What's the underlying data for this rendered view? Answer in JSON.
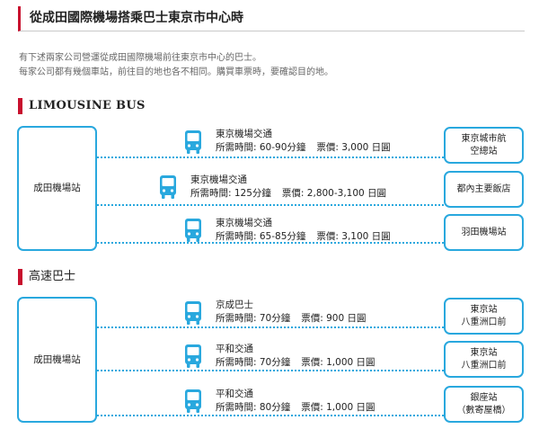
{
  "header": {
    "title": "從成田國際機場搭乘巴士東京市中心時"
  },
  "intro": {
    "line1": "有下述兩家公司營運從成田國際機場前往東京市中心的巴士。",
    "line2": "每家公司都有幾個車站，前往目的地也各不相同。購買車票時，要確認目的地。"
  },
  "sections": [
    {
      "title": "LIMOUSINE BUS",
      "origin": "成田機場站",
      "routes": [
        {
          "name": "東京機場交通",
          "time": "所需時間: 60-90分鐘",
          "fare": "票價: 3,000 日圓",
          "dest": [
            "東京城市航",
            "空總站"
          ]
        },
        {
          "name": "東京機場交通",
          "time": "所需時間: 125分鐘",
          "fare": "票價: 2,800-3,100 日圓",
          "dest": [
            "都內主要飯店"
          ]
        },
        {
          "name": "東京機場交通",
          "time": "所需時間: 65-85分鐘",
          "fare": "票價: 3,100 日圓",
          "dest": [
            "羽田機場站"
          ]
        }
      ]
    },
    {
      "title": "高速巴士",
      "origin": "成田機場站",
      "routes": [
        {
          "name": "京成巴士",
          "time": "所需時間: 70分鐘",
          "fare": "票價: 900 日圓",
          "dest": [
            "東京站",
            "八重洲口前"
          ]
        },
        {
          "name": "平和交通",
          "time": "所需時間: 70分鐘",
          "fare": "票價: 1,000 日圓",
          "dest": [
            "東京站",
            "八重洲口前"
          ]
        },
        {
          "name": "平和交通",
          "time": "所需時間: 80分鐘",
          "fare": "票價: 1,000 日圓",
          "dest": [
            "銀座站",
            "（數寄屋橋）"
          ]
        }
      ]
    }
  ],
  "colors": {
    "accent_red": "#c8102e",
    "accent_blue": "#29a8de"
  },
  "icons": {
    "bus": "bus-icon"
  }
}
